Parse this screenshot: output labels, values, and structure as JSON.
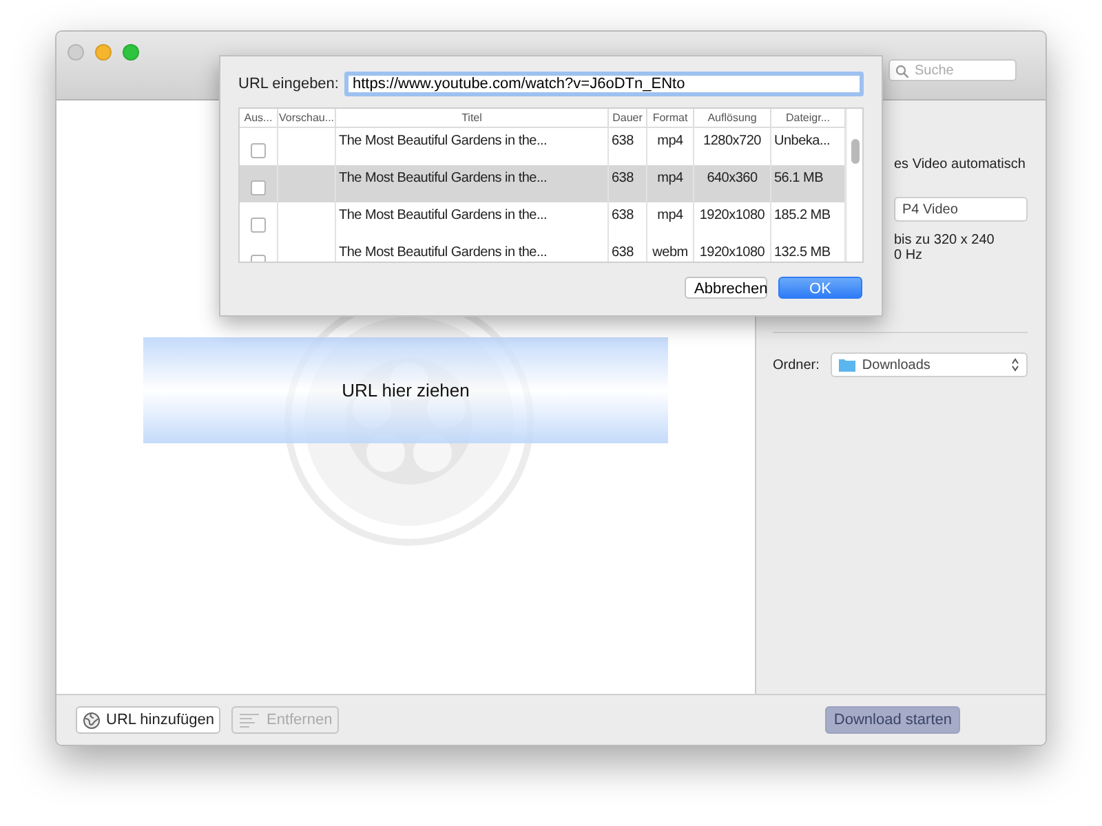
{
  "search": {
    "placeholder": "Suche"
  },
  "dialog": {
    "url_label": "URL eingeben:",
    "url_value": "https://www.youtube.com/watch?v=J6oDTn_ENto",
    "columns": [
      "Aus...",
      "Vorschau...",
      "Titel",
      "Dauer",
      "Format",
      "Auflösung",
      "Dateigr..."
    ],
    "rows": [
      {
        "checked": false,
        "selected": false,
        "title": "The Most Beautiful Gardens in the...",
        "duration": "638",
        "format": "mp4",
        "resolution": "1280x720",
        "size": "Unbeka..."
      },
      {
        "checked": false,
        "selected": true,
        "title": "The Most Beautiful Gardens in the...",
        "duration": "638",
        "format": "mp4",
        "resolution": "640x360",
        "size": "56.1 MB"
      },
      {
        "checked": false,
        "selected": false,
        "title": "The Most Beautiful Gardens in the...",
        "duration": "638",
        "format": "mp4",
        "resolution": "1920x1080",
        "size": "185.2 MB"
      },
      {
        "checked": false,
        "selected": false,
        "title": "The Most Beautiful Gardens in the...",
        "duration": "638",
        "format": "webm",
        "resolution": "1920x1080",
        "size": "132.5 MB"
      }
    ],
    "buttons": [
      {
        "label": "Abbrechen",
        "kind": "default"
      },
      {
        "label": "OK",
        "kind": "primary"
      }
    ]
  },
  "drop_zone": {
    "label": "URL hier ziehen"
  },
  "settings": {
    "auto_text": "es Video automatisch",
    "format_value": "P4 Video",
    "info_lines": [
      "bis zu 320 x 240",
      "0 Hz"
    ],
    "folder_label": "Ordner:",
    "folder_value": "Downloads"
  },
  "bottom_bar": {
    "buttons": [
      {
        "label": "URL hinzufügen",
        "kind": "add",
        "disabled": false
      },
      {
        "label": "Entfernen",
        "kind": "remove",
        "disabled": true
      }
    ],
    "start_button": {
      "label": "Download starten",
      "disabled": true
    }
  }
}
